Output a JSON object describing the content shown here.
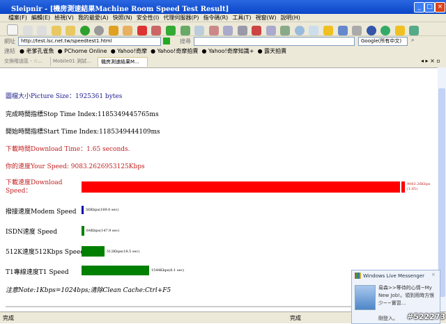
{
  "window": {
    "title": "Sleipnir - [機房測速結果Machine Room Speed Test Result]"
  },
  "menu": [
    "檔案(F)",
    "編輯(E)",
    "檢視(V)",
    "我的最愛(A)",
    "快照(N)",
    "安全性(I)",
    "代理伺服器(P)",
    "指令碼(R)",
    "工具(T)",
    "視窗(W)",
    "說明(H)"
  ],
  "address": {
    "label": "網址",
    "value": "http://test.lsc.net.tw/speedtest1.html",
    "search_label": "搜尋",
    "search_engine": "Google(所有中文)"
  },
  "links": {
    "label": "連結",
    "items": [
      "老爹孔雀魚",
      "PChome Online",
      "Yahoo!奇摩",
      "Yahoo!奇摩拍賣",
      "Yahoo!奇摩知識+",
      "露天拍賣"
    ]
  },
  "tabs": [
    "交換贈送區 - ☆...",
    "Mobile01 測試...",
    "機房測速結果M..."
  ],
  "page": {
    "picture_size": "圖檔大小Picture Size：1925361 bytes",
    "stop_time": "完成時間指標Stop Time Index:1185349445765ms",
    "start_time": "開始時間指標Start Time Index:1185349444109ms",
    "download_time": "下載時間Download Time：1.65 seconds.",
    "your_speed": "你的速度Your Speed: 9083.2626953125Kbps",
    "bars": [
      {
        "label": "下載速度Download Speed：",
        "value_kbps": 9083.26,
        "text1": "9083.26Kbps",
        "text2": "(1.65)",
        "color": "#ff0000"
      },
      {
        "label": "撥接速度Modem Speed",
        "value_kbps": 56,
        "text1": "56Kbps(169.0 sec)",
        "color": "#0000aa"
      },
      {
        "label": "ISDN速度 Speed",
        "value_kbps": 64,
        "text1": "64Kbps(147.9 sec)",
        "color": "#008000"
      },
      {
        "label": "512K速度512Kbps Speed",
        "value_kbps": 512,
        "text1": "512Kbps(18.5 sec)",
        "color": "#008000"
      },
      {
        "label": "T1專線速度T1 Speed",
        "value_kbps": 1544,
        "text1": "1544Kbps(6.1 sec)",
        "color": "#008000"
      }
    ],
    "note": "注意Note:1Kbps=1024bps;清除Clean Cache:Ctrl+F5"
  },
  "status": {
    "left": "完成",
    "right": "完成"
  },
  "messenger": {
    "title": "Windows Live Messenger",
    "message": "易森>>等待的心情~My New Job!。領到用時方恨少~~實習...",
    "action": "剛登入。"
  },
  "watermark": "#522273"
}
